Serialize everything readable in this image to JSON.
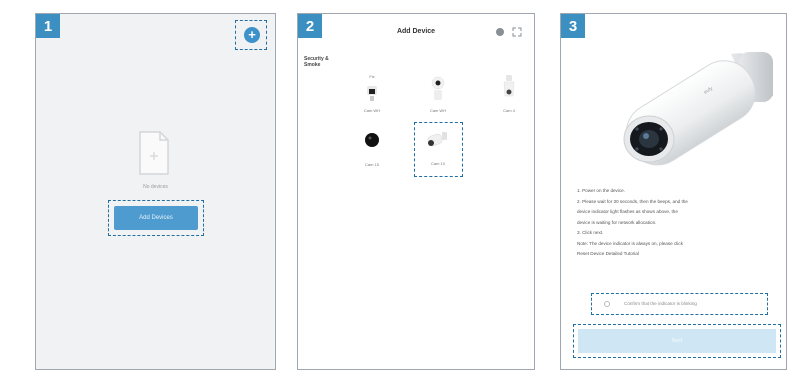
{
  "steps": [
    {
      "number": "1",
      "empty_text": "No devices",
      "add_button_label": "Add Devices",
      "add_icon": "plus-icon"
    },
    {
      "number": "2",
      "title": "Add Device",
      "category_label": "Security & Smoke",
      "header_icons": [
        "globe-icon",
        "expand-icon"
      ],
      "devices": [
        {
          "name": "Cam WH",
          "badge": "Fix",
          "icon": "camera-icon"
        },
        {
          "name": "Cam WH",
          "icon": "indoor-camera-icon"
        },
        {
          "name": "Cam 4",
          "icon": "bulb-camera-icon"
        },
        {
          "name": "Cam 15",
          "icon": "round-camera-icon"
        },
        {
          "name": "Cam 10",
          "icon": "bullet-camera-icon"
        }
      ]
    },
    {
      "number": "3",
      "instructions": [
        "1. Power on the device.",
        "2. Please wait for 30 seconds, then the beeps, and the",
        "device indicator light flashes as shown above, the",
        "device is waiting for network allocation.",
        "3. Click next.",
        "Note: The device indicator is always on, please click",
        "Reset Device Detailed Tutorial"
      ],
      "confirm_label": "Confirm that the indicator is blinking",
      "next_button_label": "Next"
    }
  ],
  "accent_color": "#3c8fc1",
  "highlight_color": "#1f6fa3"
}
